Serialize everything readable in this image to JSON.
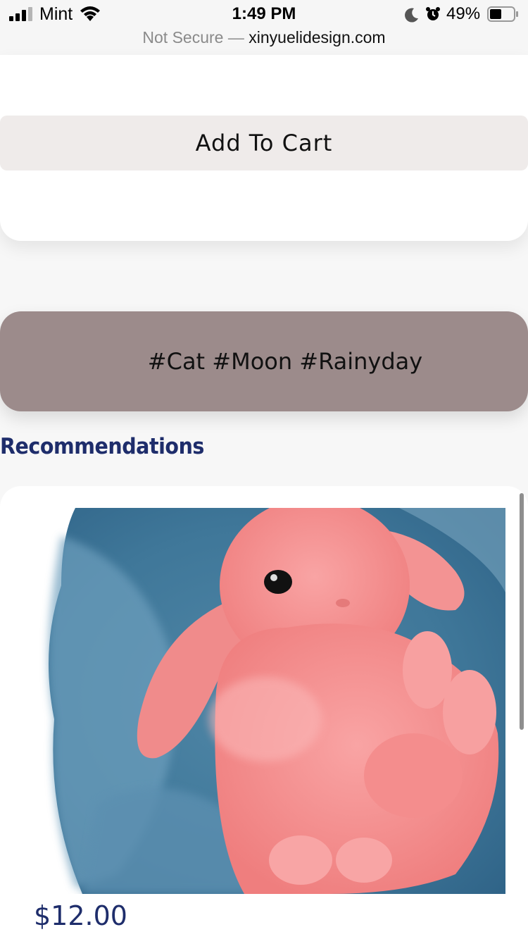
{
  "status_bar": {
    "carrier": "Mint",
    "time": "1:49 PM",
    "battery_percent": "49%",
    "battery_level": 0.49
  },
  "url_bar": {
    "security": "Not Secure —",
    "domain": "xinyuelidesign.com"
  },
  "cart": {
    "add_to_cart_label": "Add To Cart"
  },
  "tags": {
    "text": "#Cat #Moon #Rainyday"
  },
  "recommendations": {
    "heading": "Recommendations",
    "items": [
      {
        "price": "$12.00",
        "image_icon": "pink-bunny-painting"
      }
    ]
  },
  "colors": {
    "brand_navy": "#1e2d6b",
    "tag_background": "#9c8b8b",
    "button_background": "#efebea"
  }
}
